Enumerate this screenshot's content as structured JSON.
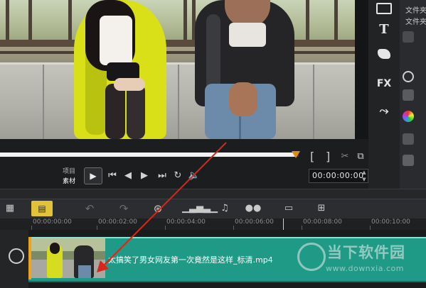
{
  "sidebar": {
    "labels": [
      "文件夹",
      "文件夹"
    ],
    "tool_icons": [
      "media-icon",
      "title-icon",
      "transition-icon",
      "fx-icon",
      "path-icon"
    ],
    "title_icon_text": "T",
    "fx_icon_text": "FX"
  },
  "player": {
    "mode_project": "项目",
    "mode_clip": "素材",
    "timecode": "00:00:00:00",
    "scrub_progress": 0.99,
    "mark_in": "[",
    "mark_out": "]"
  },
  "timeline": {
    "ruler_labels": [
      "00:00:00:00",
      "00:00:02:00",
      "00:00:04:00",
      "00:00:06:00",
      "00:00:08:00",
      "00:00:10:00"
    ],
    "toolbar_icons": [
      "timeline-view-icon",
      "storyboard-view-icon",
      "undo-icon",
      "redo-icon",
      "record-capture-icon",
      "audio-mixer-icon",
      "auto-music-icon",
      "motion-track-icon",
      "subtitle-editor-icon",
      "multi-camera-icon"
    ],
    "clip": {
      "name": "太搞笑了男女网友第一次竟然是这样_标清.mp4",
      "color": "#1f9a86"
    }
  },
  "watermark": {
    "brand": "当下软件园",
    "url": "www.downxia.com"
  },
  "colors": {
    "accent_orange": "#e08a1c",
    "storyboard_yellow": "#e1c33a",
    "annotation_red": "#d9261c"
  }
}
